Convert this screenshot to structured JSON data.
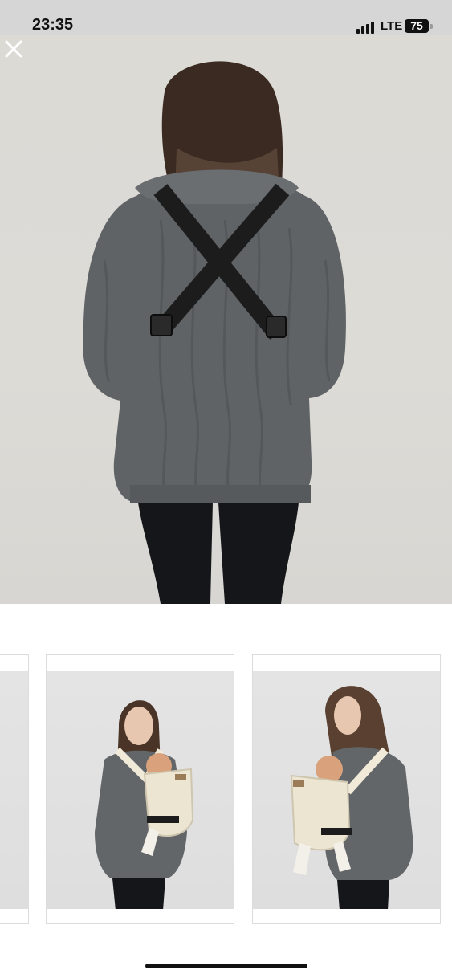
{
  "status_bar": {
    "time": "23:35",
    "network": "LTE",
    "battery": "75",
    "signal_icon": "signal-bars-icon"
  },
  "viewer": {
    "close_icon": "close-icon",
    "main_image": "woman-back-view-crossed-carrier-straps",
    "thumbnails": [
      {
        "image": "partial-previous-photo"
      },
      {
        "image": "woman-front-view-baby-carrier"
      },
      {
        "image": "woman-side-view-baby-carrier"
      }
    ]
  },
  "colors": {
    "status_bar_bg": "#d6d6d6",
    "sweater": "#5f6366",
    "strap": "#1c1c1c",
    "carrier": "#ece5d2",
    "leggings": "#151619"
  }
}
